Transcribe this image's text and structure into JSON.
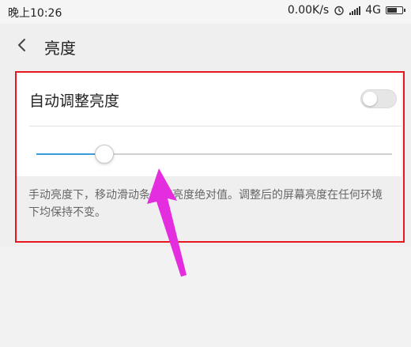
{
  "status_bar": {
    "time": "晚上10:26",
    "network_speed": "0.00K/s",
    "network_type": "4G",
    "icons": [
      "alarm-icon",
      "signal-icon",
      "battery-icon"
    ]
  },
  "header": {
    "back_icon": "chevron-left-icon",
    "title": "亮度"
  },
  "auto_brightness": {
    "label": "自动调整亮度",
    "enabled": false
  },
  "brightness_slider": {
    "value": 0.19,
    "fill_color": "#3a9bdc"
  },
  "description": "手动亮度下，移动滑动条调节亮度绝对值。调整后的屏幕亮度在任何环境下均保持不变。",
  "annotations": {
    "highlight_color": "#e8161e",
    "arrow_color": "#e52de0"
  }
}
